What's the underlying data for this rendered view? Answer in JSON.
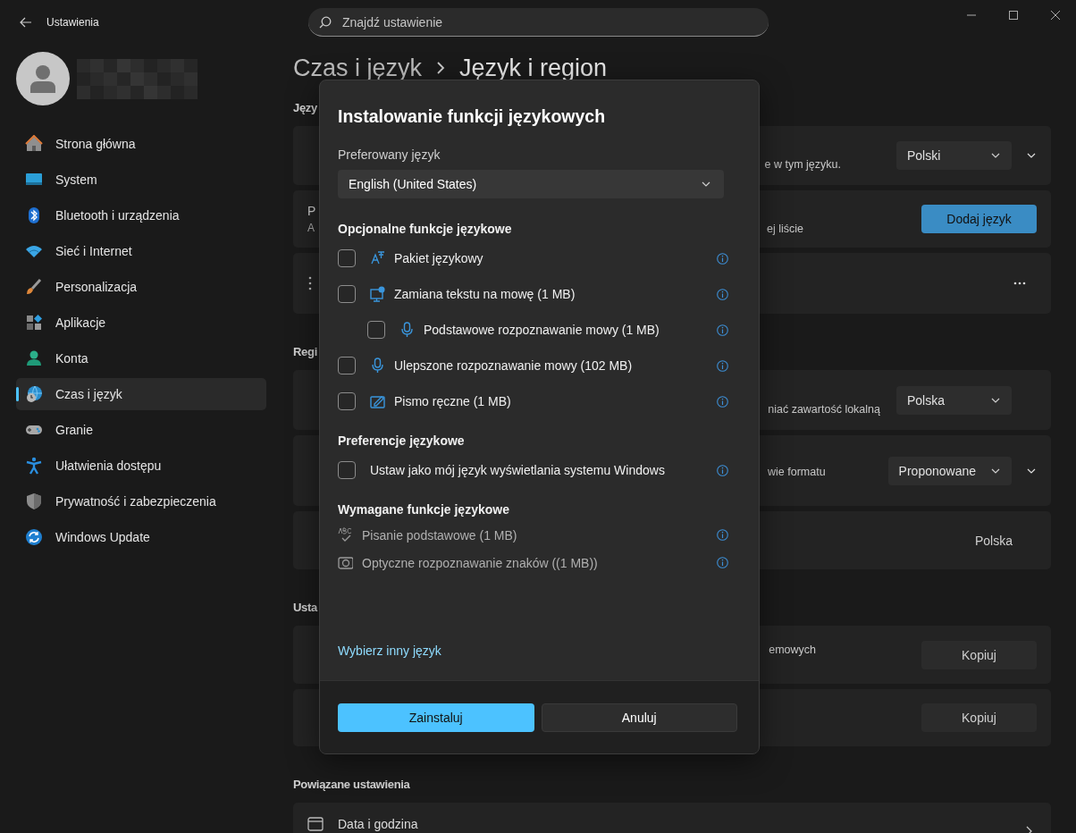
{
  "window": {
    "title": "Ustawienia"
  },
  "search": {
    "placeholder": "Znajdź ustawienie"
  },
  "sidebar": {
    "items": [
      {
        "label": "Strona główna",
        "selected": false
      },
      {
        "label": "System",
        "selected": false
      },
      {
        "label": "Bluetooth i urządzenia",
        "selected": false
      },
      {
        "label": "Sieć i Internet",
        "selected": false
      },
      {
        "label": "Personalizacja",
        "selected": false
      },
      {
        "label": "Aplikacje",
        "selected": false
      },
      {
        "label": "Konta",
        "selected": false
      },
      {
        "label": "Czas i język",
        "selected": true
      },
      {
        "label": "Granie",
        "selected": false
      },
      {
        "label": "Ułatwienia dostępu",
        "selected": false
      },
      {
        "label": "Prywatność i zabezpieczenia",
        "selected": false
      },
      {
        "label": "Windows Update",
        "selected": false
      }
    ]
  },
  "breadcrumb": {
    "parent": "Czas i język",
    "current": "Język i region"
  },
  "sections": [
    {
      "heading": "Języ",
      "cards": [
        {
          "kind": "dropdown",
          "tail": "e w tym języku.",
          "value": "Polski",
          "expandable": true
        },
        {
          "kind": "button",
          "lead": [
            "P",
            "A"
          ],
          "tail": "ej liście",
          "value": "Dodaj język",
          "primary": true
        },
        {
          "kind": "menu"
        }
      ]
    },
    {
      "heading": "Regi",
      "cards": [
        {
          "kind": "dropdown",
          "tail": "niać zawartość lokalną",
          "value": "Polska",
          "expandable": false
        },
        {
          "kind": "dropdown",
          "tail": "wie formatu",
          "value": "Proponowane",
          "expandable": true
        },
        {
          "kind": "text",
          "value": "Polska"
        }
      ]
    },
    {
      "heading": "Usta",
      "cards": [
        {
          "kind": "button",
          "tail": "emowych",
          "value": "Kopiuj",
          "primary": false
        },
        {
          "kind": "button",
          "value": "Kopiuj",
          "primary": false
        }
      ]
    },
    {
      "heading": "Powiązane ustawienia",
      "cards": [
        {
          "kind": "link",
          "title": "Data i godzina"
        }
      ]
    }
  ],
  "dialog": {
    "title": "Instalowanie funkcji językowych",
    "language_label": "Preferowany język",
    "language_value": "English (United States)",
    "sections": [
      {
        "heading": "Opcjonalne funkcje językowe",
        "items": [
          {
            "kind": "checkbox",
            "label": "Pakiet językowy",
            "checked": false
          },
          {
            "kind": "checkbox",
            "label": "Zamiana tekstu na mowę (1 MB)",
            "checked": false,
            "children": [
              {
                "kind": "checkbox",
                "label": "Podstawowe rozpoznawanie mowy (1 MB)",
                "checked": false
              }
            ]
          },
          {
            "kind": "checkbox",
            "label": "Ulepszone rozpoznawanie mowy (102 MB)",
            "checked": false
          },
          {
            "kind": "checkbox",
            "label": "Pismo ręczne (1 MB)",
            "checked": false
          }
        ]
      },
      {
        "heading": "Preferencje językowe",
        "items": [
          {
            "kind": "checkbox",
            "label": "Ustaw jako mój język wyświetlania systemu Windows",
            "checked": false
          }
        ]
      },
      {
        "heading": "Wymagane funkcje językowe",
        "items": [
          {
            "kind": "required",
            "label": "Pisanie podstawowe (1 MB)"
          },
          {
            "kind": "required",
            "label": "Optyczne rozpoznawanie znaków ((1 MB))"
          }
        ]
      }
    ],
    "link": "Wybierz inny język",
    "buttons": [
      {
        "label": "Zainstaluj",
        "kind": "primary"
      },
      {
        "label": "Anuluj",
        "kind": "secondary"
      }
    ]
  }
}
